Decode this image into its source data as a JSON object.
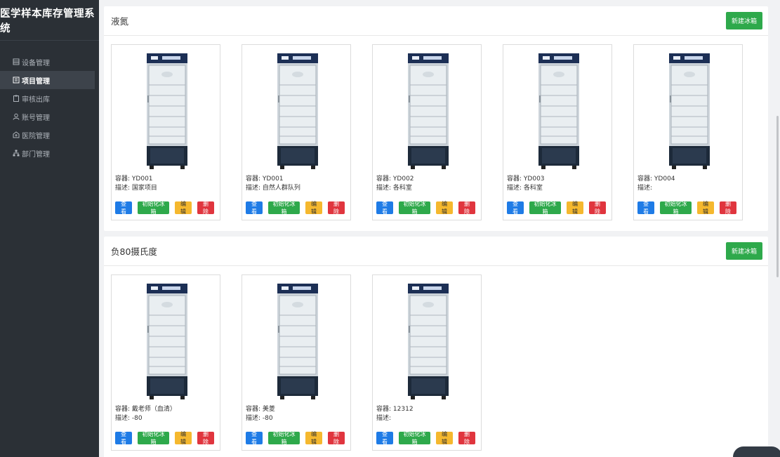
{
  "app": {
    "title": "医学样本库存管理系统"
  },
  "sidebar": {
    "items": [
      {
        "label": "设备管理",
        "icon": "device-icon",
        "active": false
      },
      {
        "label": "项目管理",
        "icon": "project-icon",
        "active": true
      },
      {
        "label": "审核出库",
        "icon": "clipboard-icon",
        "active": false
      },
      {
        "label": "账号管理",
        "icon": "user-icon",
        "active": false
      },
      {
        "label": "医院管理",
        "icon": "hospital-icon",
        "active": false
      },
      {
        "label": "部门管理",
        "icon": "sitemap-icon",
        "active": false
      }
    ]
  },
  "sections": [
    {
      "title": "液氮",
      "new_label": "新建冰箱",
      "cards": [
        {
          "container_label": "容器:",
          "container": "YD001",
          "desc_label": "描述:",
          "desc": "国家项目"
        },
        {
          "container_label": "容器:",
          "container": "YD001",
          "desc_label": "描述:",
          "desc": "自然人群队列"
        },
        {
          "container_label": "容器:",
          "container": "YD002",
          "desc_label": "描述:",
          "desc": "各科室"
        },
        {
          "container_label": "容器:",
          "container": "YD003",
          "desc_label": "描述:",
          "desc": "各科室"
        },
        {
          "container_label": "容器:",
          "container": "YD004",
          "desc_label": "描述:",
          "desc": ""
        }
      ]
    },
    {
      "title": "负80摄氏度",
      "new_label": "新建冰箱",
      "cards": [
        {
          "container_label": "容器:",
          "container": "戴老师（血清）",
          "desc_label": "描述:",
          "desc": "-80"
        },
        {
          "container_label": "容器:",
          "container": "美菱",
          "desc_label": "描述:",
          "desc": "-80"
        },
        {
          "container_label": "容器:",
          "container": "12312",
          "desc_label": "描述:",
          "desc": ""
        }
      ]
    }
  ],
  "card_buttons": {
    "view": "查看",
    "init": "初始化冰箱",
    "edit": "编辑",
    "delete": "删除"
  },
  "colors": {
    "sidebar": "#2b3036",
    "primary": "#1e7be6",
    "success": "#2ea94b",
    "warning": "#f5b82e",
    "danger": "#e0353e"
  }
}
